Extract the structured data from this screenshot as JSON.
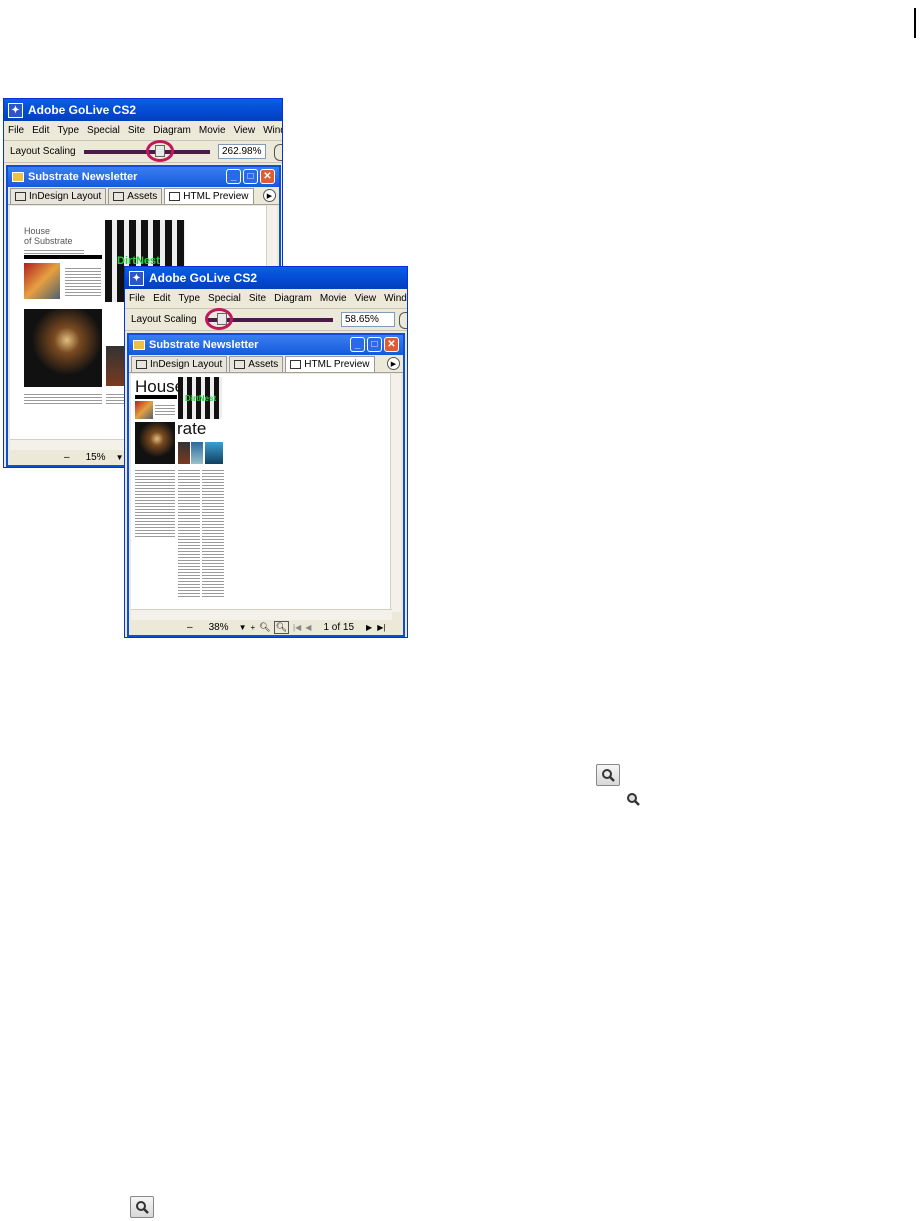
{
  "app_window_1": {
    "title": "Adobe GoLive CS2",
    "menu": [
      "File",
      "Edit",
      "Type",
      "Special",
      "Site",
      "Diagram",
      "Movie",
      "View",
      "Window"
    ],
    "layout_scaling_label": "Layout Scaling",
    "layout_scaling_value": "262.98%",
    "slider_fraction": 0.6,
    "document": {
      "title": "Substrate Newsletter",
      "tabs": [
        "InDesign Layout",
        "Assets",
        "HTML Preview"
      ],
      "active_tab": "HTML Preview",
      "preview_heading_line1": "House",
      "preview_heading_line2": "of Substrate",
      "preview_image_caption": "DirtNest",
      "zoom_value": "15%"
    }
  },
  "app_window_2": {
    "title": "Adobe GoLive CS2",
    "menu": [
      "File",
      "Edit",
      "Type",
      "Special",
      "Site",
      "Diagram",
      "Movie",
      "View",
      "Window"
    ],
    "layout_scaling_label": "Layout Scaling",
    "layout_scaling_value": "58.65%",
    "slider_fraction": 0.1,
    "document": {
      "title": "Substrate Newsletter",
      "tabs": [
        "InDesign Layout",
        "Assets",
        "HTML Preview"
      ],
      "active_tab": "HTML Preview",
      "preview_heading_top": "House",
      "preview_heading_bottom": "rate",
      "preview_image_caption": "DirtNest",
      "zoom_value": "38%",
      "page_indicator": "1 of 15"
    }
  },
  "icons": {
    "zoom_tool_icon_1": "magnifier-icon",
    "zoom_tool_icon_2": "magnifier-icon",
    "zoom_tool_icon_3": "magnifier-icon"
  },
  "colors": {
    "titlebar_blue": "#0449d1",
    "slider_track": "#4a1a4a",
    "highlight_circle": "#c0185a",
    "close_button": "#e35b32"
  }
}
